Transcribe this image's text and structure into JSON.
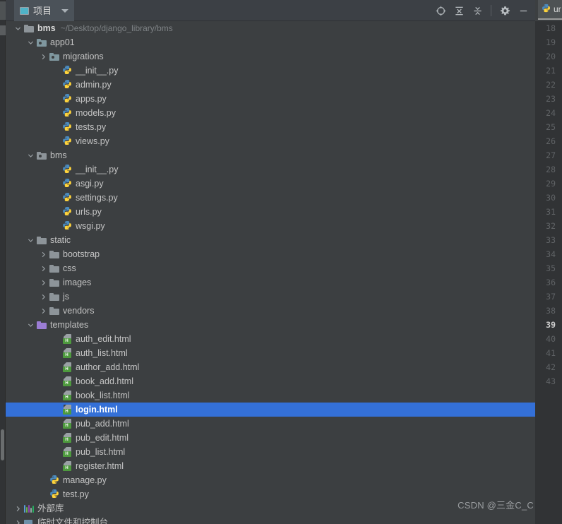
{
  "toolbar": {
    "project_tab_label": "项目",
    "project_tab_icon": "project-window-icon",
    "dropdown_icon": "chevron-down-icon",
    "buttons": [
      {
        "name": "locate-icon",
        "title": "选择打开的文件"
      },
      {
        "name": "collapse-all-icon",
        "title": "全部折叠"
      },
      {
        "name": "expand-all-icon",
        "title": "全部展开"
      },
      {
        "name": "settings-gear-icon",
        "title": "设置"
      },
      {
        "name": "hide-minimize-icon",
        "title": "隐藏"
      }
    ]
  },
  "editor_tab": {
    "label": "ur",
    "icon": "python-file-icon"
  },
  "tree": {
    "rows": [
      {
        "depth": 0,
        "arrow": "expanded",
        "icon": "folder-grey",
        "label": "bms",
        "bold": true,
        "path": "~/Desktop/django_library/bms",
        "selected": false
      },
      {
        "depth": 1,
        "arrow": "expanded",
        "icon": "folder-module-teal",
        "label": "app01",
        "bold": false,
        "path": "",
        "selected": false
      },
      {
        "depth": 2,
        "arrow": "collapsed",
        "icon": "folder-module-teal",
        "label": "migrations",
        "bold": false,
        "path": "",
        "selected": false
      },
      {
        "depth": 3,
        "arrow": "none",
        "icon": "python-file",
        "label": "__init__.py",
        "bold": false,
        "path": "",
        "selected": false
      },
      {
        "depth": 3,
        "arrow": "none",
        "icon": "python-file",
        "label": "admin.py",
        "bold": false,
        "path": "",
        "selected": false
      },
      {
        "depth": 3,
        "arrow": "none",
        "icon": "python-file",
        "label": "apps.py",
        "bold": false,
        "path": "",
        "selected": false
      },
      {
        "depth": 3,
        "arrow": "none",
        "icon": "python-file",
        "label": "models.py",
        "bold": false,
        "path": "",
        "selected": false
      },
      {
        "depth": 3,
        "arrow": "none",
        "icon": "python-file",
        "label": "tests.py",
        "bold": false,
        "path": "",
        "selected": false
      },
      {
        "depth": 3,
        "arrow": "none",
        "icon": "python-file",
        "label": "views.py",
        "bold": false,
        "path": "",
        "selected": false
      },
      {
        "depth": 1,
        "arrow": "expanded",
        "icon": "folder-module-grey",
        "label": "bms",
        "bold": false,
        "path": "",
        "selected": false
      },
      {
        "depth": 3,
        "arrow": "none",
        "icon": "python-file",
        "label": "__init__.py",
        "bold": false,
        "path": "",
        "selected": false
      },
      {
        "depth": 3,
        "arrow": "none",
        "icon": "python-file",
        "label": "asgi.py",
        "bold": false,
        "path": "",
        "selected": false
      },
      {
        "depth": 3,
        "arrow": "none",
        "icon": "python-file",
        "label": "settings.py",
        "bold": false,
        "path": "",
        "selected": false
      },
      {
        "depth": 3,
        "arrow": "none",
        "icon": "python-file",
        "label": "urls.py",
        "bold": false,
        "path": "",
        "selected": false
      },
      {
        "depth": 3,
        "arrow": "none",
        "icon": "python-file",
        "label": "wsgi.py",
        "bold": false,
        "path": "",
        "selected": false
      },
      {
        "depth": 1,
        "arrow": "expanded",
        "icon": "folder-grey",
        "label": "static",
        "bold": false,
        "path": "",
        "selected": false
      },
      {
        "depth": 2,
        "arrow": "collapsed",
        "icon": "folder-grey",
        "label": "bootstrap",
        "bold": false,
        "path": "",
        "selected": false
      },
      {
        "depth": 2,
        "arrow": "collapsed",
        "icon": "folder-grey",
        "label": "css",
        "bold": false,
        "path": "",
        "selected": false
      },
      {
        "depth": 2,
        "arrow": "collapsed",
        "icon": "folder-grey",
        "label": "images",
        "bold": false,
        "path": "",
        "selected": false
      },
      {
        "depth": 2,
        "arrow": "collapsed",
        "icon": "folder-grey",
        "label": "js",
        "bold": false,
        "path": "",
        "selected": false
      },
      {
        "depth": 2,
        "arrow": "collapsed",
        "icon": "folder-grey",
        "label": "vendors",
        "bold": false,
        "path": "",
        "selected": false
      },
      {
        "depth": 1,
        "arrow": "expanded",
        "icon": "folder-purple",
        "label": "templates",
        "bold": false,
        "path": "",
        "selected": false
      },
      {
        "depth": 3,
        "arrow": "none",
        "icon": "html-file",
        "label": "auth_edit.html",
        "bold": false,
        "path": "",
        "selected": false
      },
      {
        "depth": 3,
        "arrow": "none",
        "icon": "html-file",
        "label": "auth_list.html",
        "bold": false,
        "path": "",
        "selected": false
      },
      {
        "depth": 3,
        "arrow": "none",
        "icon": "html-file",
        "label": "author_add.html",
        "bold": false,
        "path": "",
        "selected": false
      },
      {
        "depth": 3,
        "arrow": "none",
        "icon": "html-file",
        "label": "book_add.html",
        "bold": false,
        "path": "",
        "selected": false
      },
      {
        "depth": 3,
        "arrow": "none",
        "icon": "html-file",
        "label": "book_list.html",
        "bold": false,
        "path": "",
        "selected": false
      },
      {
        "depth": 3,
        "arrow": "none",
        "icon": "html-file",
        "label": "login.html",
        "bold": false,
        "path": "",
        "selected": true
      },
      {
        "depth": 3,
        "arrow": "none",
        "icon": "html-file",
        "label": "pub_add.html",
        "bold": false,
        "path": "",
        "selected": false
      },
      {
        "depth": 3,
        "arrow": "none",
        "icon": "html-file",
        "label": "pub_edit.html",
        "bold": false,
        "path": "",
        "selected": false
      },
      {
        "depth": 3,
        "arrow": "none",
        "icon": "html-file",
        "label": "pub_list.html",
        "bold": false,
        "path": "",
        "selected": false
      },
      {
        "depth": 3,
        "arrow": "none",
        "icon": "html-file",
        "label": "register.html",
        "bold": false,
        "path": "",
        "selected": false
      },
      {
        "depth": 2,
        "arrow": "none",
        "icon": "python-file",
        "label": "manage.py",
        "bold": false,
        "path": "",
        "selected": false
      },
      {
        "depth": 2,
        "arrow": "none",
        "icon": "python-file",
        "label": "test.py",
        "bold": false,
        "path": "",
        "selected": false
      },
      {
        "depth": 0,
        "arrow": "collapsed",
        "icon": "external-libraries",
        "label": "外部库",
        "bold": false,
        "path": "",
        "selected": false
      },
      {
        "depth": 0,
        "arrow": "collapsed",
        "icon": "scratches-console",
        "label": "临时文件和控制台",
        "bold": false,
        "path": "",
        "selected": false
      }
    ]
  },
  "gutter": {
    "lines": [
      18,
      19,
      20,
      21,
      22,
      23,
      24,
      25,
      26,
      27,
      28,
      29,
      30,
      31,
      32,
      33,
      34,
      35,
      36,
      37,
      38,
      39,
      40,
      41,
      42,
      43
    ],
    "current_line": 39,
    "marker_line": 42
  },
  "watermark": {
    "text": "CSDN @三金C_C"
  },
  "colors": {
    "selection_blue": "#3470d7",
    "panel_bg": "#3c3f41",
    "gutter_bg": "#313335",
    "toolbar_bg": "#3c4045",
    "template_folder": "#9b7dd4",
    "html_badge_green": "#4e9a3e"
  }
}
